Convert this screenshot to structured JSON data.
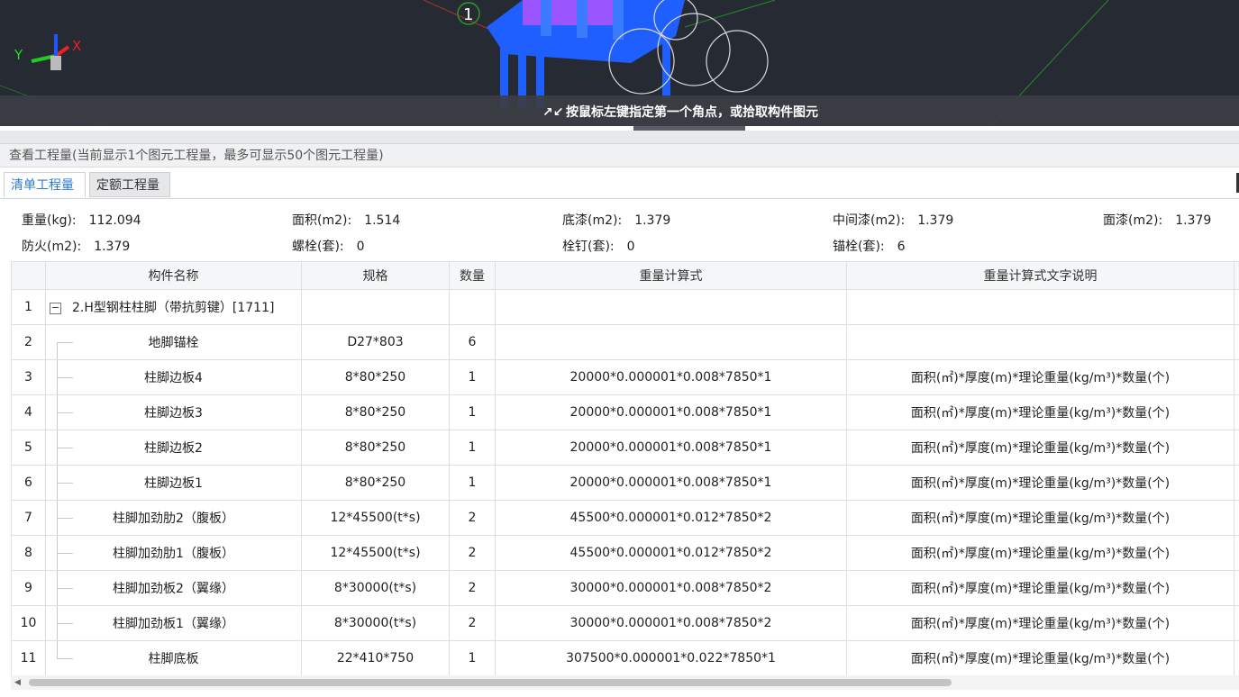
{
  "viewport": {
    "axis_x": "X",
    "axis_y": "Y",
    "axis_label_1": "1",
    "status_hint": "按鼠标左键指定第一个角点，或拾取构件图元",
    "hint_icon": "shrink-arrows-icon",
    "colors": {
      "background": "#262a33",
      "steel_blue": "#1f5fff",
      "purple": "#9a55ff"
    }
  },
  "panel": {
    "title": "查看工程量(当前显示1个图元工程量，最多可显示50个图元工程量)",
    "tabs": [
      "清单工程量",
      "定额工程量"
    ],
    "active_tab": "清单工程量"
  },
  "summary": [
    {
      "label": "重量(kg):",
      "value": "112.094"
    },
    {
      "label": "面积(m2):",
      "value": "1.514"
    },
    {
      "label": "底漆(m2):",
      "value": "1.379"
    },
    {
      "label": "中间漆(m2):",
      "value": "1.379"
    },
    {
      "label": "面漆(m2):",
      "value": "1.379"
    },
    {
      "label": "防火(m2):",
      "value": "1.379"
    },
    {
      "label": "螺栓(套):",
      "value": "0"
    },
    {
      "label": "栓钉(套):",
      "value": "0"
    },
    {
      "label": "锚栓(套):",
      "value": "6"
    }
  ],
  "table": {
    "headers": [
      "",
      "构件名称",
      "规格",
      "数量",
      "重量计算式",
      "重量计算式文字说明"
    ],
    "rows": [
      {
        "no": "1",
        "name": "2.H型钢柱柱脚（带抗剪键）[1711]",
        "spec": "",
        "qty": "",
        "formula": "",
        "desc": ""
      },
      {
        "no": "2",
        "name": "地脚锚栓",
        "spec": "D27*803",
        "qty": "6",
        "formula": "",
        "desc": ""
      },
      {
        "no": "3",
        "name": "柱脚边板4",
        "spec": "8*80*250",
        "qty": "1",
        "formula": "20000*0.000001*0.008*7850*1",
        "desc": "面积(㎡)*厚度(m)*理论重量(kg/m³)*数量(个)"
      },
      {
        "no": "4",
        "name": "柱脚边板3",
        "spec": "8*80*250",
        "qty": "1",
        "formula": "20000*0.000001*0.008*7850*1",
        "desc": "面积(㎡)*厚度(m)*理论重量(kg/m³)*数量(个)"
      },
      {
        "no": "5",
        "name": "柱脚边板2",
        "spec": "8*80*250",
        "qty": "1",
        "formula": "20000*0.000001*0.008*7850*1",
        "desc": "面积(㎡)*厚度(m)*理论重量(kg/m³)*数量(个)"
      },
      {
        "no": "6",
        "name": "柱脚边板1",
        "spec": "8*80*250",
        "qty": "1",
        "formula": "20000*0.000001*0.008*7850*1",
        "desc": "面积(㎡)*厚度(m)*理论重量(kg/m³)*数量(个)"
      },
      {
        "no": "7",
        "name": "柱脚加劲肋2（腹板）",
        "spec": "12*45500(t*s)",
        "qty": "2",
        "formula": "45500*0.000001*0.012*7850*2",
        "desc": "面积(㎡)*厚度(m)*理论重量(kg/m³)*数量(个)"
      },
      {
        "no": "8",
        "name": "柱脚加劲肋1（腹板）",
        "spec": "12*45500(t*s)",
        "qty": "2",
        "formula": "45500*0.000001*0.012*7850*2",
        "desc": "面积(㎡)*厚度(m)*理论重量(kg/m³)*数量(个)"
      },
      {
        "no": "9",
        "name": "柱脚加劲板2（翼缘）",
        "spec": "8*30000(t*s)",
        "qty": "2",
        "formula": "30000*0.000001*0.008*7850*2",
        "desc": "面积(㎡)*厚度(m)*理论重量(kg/m³)*数量(个)"
      },
      {
        "no": "10",
        "name": "柱脚加劲板1（翼缘）",
        "spec": "8*30000(t*s)",
        "qty": "2",
        "formula": "30000*0.000001*0.008*7850*2",
        "desc": "面积(㎡)*厚度(m)*理论重量(kg/m³)*数量(个)"
      },
      {
        "no": "11",
        "name": "柱脚底板",
        "spec": "22*410*750",
        "qty": "1",
        "formula": "307500*0.000001*0.022*7850*1",
        "desc": "面积(㎡)*厚度(m)*理论重量(kg/m³)*数量(个)"
      }
    ]
  }
}
